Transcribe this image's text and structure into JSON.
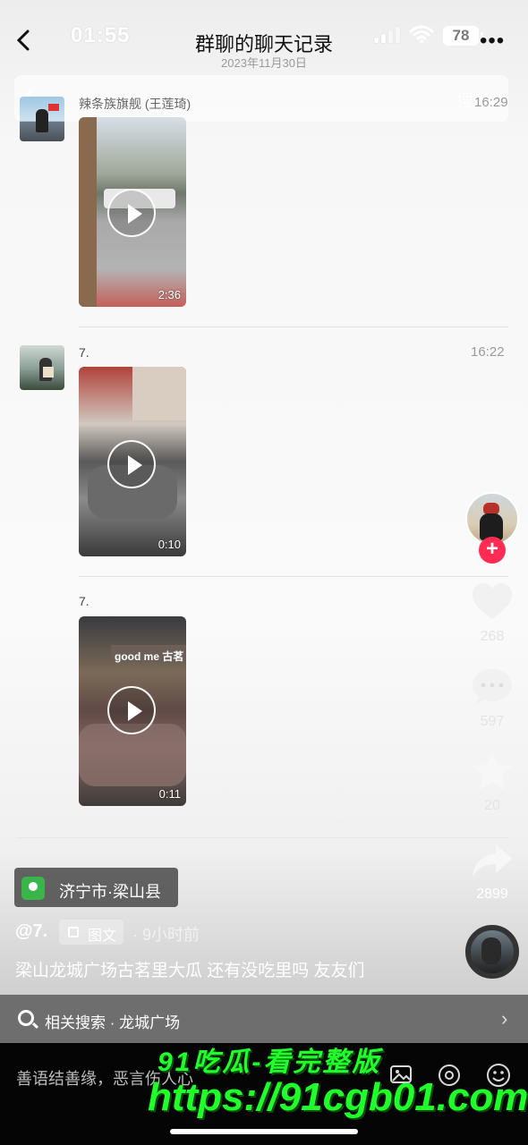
{
  "status_bar": {
    "time": "01:55",
    "battery": "78"
  },
  "nav": {
    "back_icon": "chevron-left",
    "title": "群聊的聊天记录",
    "date": "2023年11月30日",
    "more": "•••"
  },
  "overlay": {
    "hint": "辣条族旗舰 (王莲琦)",
    "search": "搜索"
  },
  "messages": [
    {
      "sender": "辣条族旗舰 (王莲琦)",
      "time": "16:29",
      "duration": "2:36"
    },
    {
      "sender": "7.",
      "time": "16:22",
      "duration": "0:10"
    },
    {
      "sender": "7.",
      "time": "",
      "duration": "0:11"
    }
  ],
  "rail": {
    "likes": "268",
    "comments": "597",
    "favorites": "20",
    "shares": "2899",
    "follow": "+"
  },
  "post": {
    "location": "济宁市·梁山县",
    "author": "@7.",
    "tag": "图文",
    "ago": "· 9小时前",
    "caption": "梁山龙城广场古茗里大瓜 还有没吃里吗 友友们"
  },
  "related": {
    "text": "相关搜索 · 龙城广场",
    "arrow": "›"
  },
  "bottom": {
    "comment_placeholder": "善语结善缘，恶言伤人心"
  },
  "watermark": {
    "line1": "91吃瓜-看完整版",
    "line2": "https://91cgb01.com"
  }
}
